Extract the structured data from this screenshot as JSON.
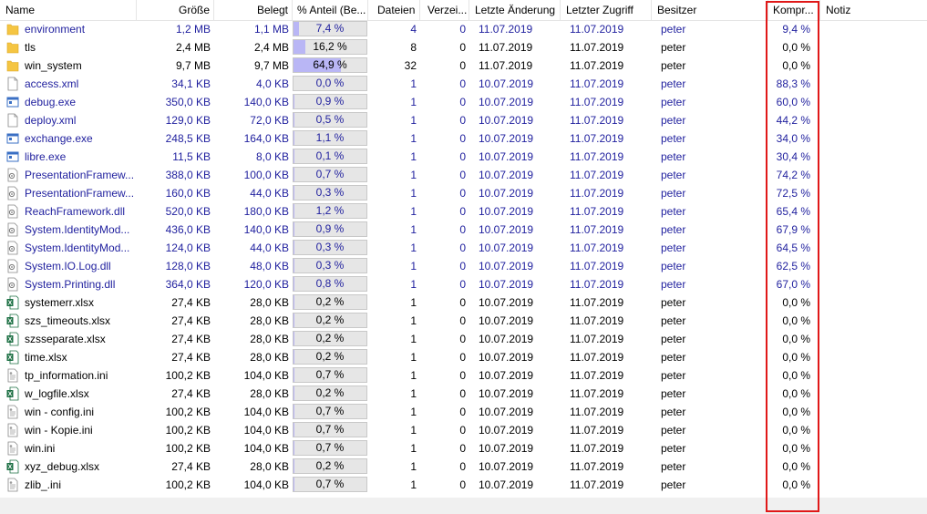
{
  "columns": {
    "name": "Name",
    "size": "Größe",
    "allocated": "Belegt",
    "percent": "% Anteil (Be...",
    "files": "Dateien",
    "folders": "Verzei...",
    "modified": "Letzte Änderung",
    "accessed": "Letzter Zugriff",
    "owner": "Besitzer",
    "compression": "Kompr...",
    "note": "Notiz"
  },
  "colors": {
    "blue_text": "#1f1f9e",
    "bar_fill": "#b9b6f5",
    "bar_bg": "#e6e6e6",
    "highlight_box": "#e01818"
  },
  "rows": [
    {
      "name": "environment",
      "icon": "folder-icon",
      "size": "1,2 MB",
      "alloc": "1,1 MB",
      "pct": "7,4 %",
      "pct_value": 7.4,
      "files": "4",
      "folders": "0",
      "mod": "11.07.2019",
      "acc": "11.07.2019",
      "owner": "peter",
      "comp": "9,4 %",
      "blue": true
    },
    {
      "name": "tls",
      "icon": "folder-icon",
      "size": "2,4 MB",
      "alloc": "2,4 MB",
      "pct": "16,2 %",
      "pct_value": 16.2,
      "files": "8",
      "folders": "0",
      "mod": "11.07.2019",
      "acc": "11.07.2019",
      "owner": "peter",
      "comp": "0,0 %",
      "blue": false
    },
    {
      "name": "win_system",
      "icon": "folder-icon",
      "size": "9,7 MB",
      "alloc": "9,7 MB",
      "pct": "64,9 %",
      "pct_value": 64.9,
      "files": "32",
      "folders": "0",
      "mod": "11.07.2019",
      "acc": "11.07.2019",
      "owner": "peter",
      "comp": "0,0 %",
      "blue": false
    },
    {
      "name": "access.xml",
      "icon": "xml-file-icon",
      "size": "34,1 KB",
      "alloc": "4,0 KB",
      "pct": "0,0 %",
      "pct_value": 0.0,
      "files": "1",
      "folders": "0",
      "mod": "10.07.2019",
      "acc": "11.07.2019",
      "owner": "peter",
      "comp": "88,3 %",
      "blue": true
    },
    {
      "name": "debug.exe",
      "icon": "exe-file-icon",
      "size": "350,0 KB",
      "alloc": "140,0 KB",
      "pct": "0,9 %",
      "pct_value": 0.9,
      "files": "1",
      "folders": "0",
      "mod": "10.07.2019",
      "acc": "11.07.2019",
      "owner": "peter",
      "comp": "60,0 %",
      "blue": true
    },
    {
      "name": "deploy.xml",
      "icon": "xml-file-icon",
      "size": "129,0 KB",
      "alloc": "72,0 KB",
      "pct": "0,5 %",
      "pct_value": 0.5,
      "files": "1",
      "folders": "0",
      "mod": "10.07.2019",
      "acc": "11.07.2019",
      "owner": "peter",
      "comp": "44,2 %",
      "blue": true
    },
    {
      "name": "exchange.exe",
      "icon": "exe-file-icon",
      "size": "248,5 KB",
      "alloc": "164,0 KB",
      "pct": "1,1 %",
      "pct_value": 1.1,
      "files": "1",
      "folders": "0",
      "mod": "10.07.2019",
      "acc": "11.07.2019",
      "owner": "peter",
      "comp": "34,0 %",
      "blue": true
    },
    {
      "name": "libre.exe",
      "icon": "exe-file-icon",
      "size": "11,5 KB",
      "alloc": "8,0 KB",
      "pct": "0,1 %",
      "pct_value": 0.1,
      "files": "1",
      "folders": "0",
      "mod": "10.07.2019",
      "acc": "11.07.2019",
      "owner": "peter",
      "comp": "30,4 %",
      "blue": true
    },
    {
      "name": "PresentationFramew...",
      "icon": "dll-file-icon",
      "size": "388,0 KB",
      "alloc": "100,0 KB",
      "pct": "0,7 %",
      "pct_value": 0.7,
      "files": "1",
      "folders": "0",
      "mod": "10.07.2019",
      "acc": "11.07.2019",
      "owner": "peter",
      "comp": "74,2 %",
      "blue": true
    },
    {
      "name": "PresentationFramew...",
      "icon": "dll-file-icon",
      "size": "160,0 KB",
      "alloc": "44,0 KB",
      "pct": "0,3 %",
      "pct_value": 0.3,
      "files": "1",
      "folders": "0",
      "mod": "10.07.2019",
      "acc": "11.07.2019",
      "owner": "peter",
      "comp": "72,5 %",
      "blue": true
    },
    {
      "name": "ReachFramework.dll",
      "icon": "dll-file-icon",
      "size": "520,0 KB",
      "alloc": "180,0 KB",
      "pct": "1,2 %",
      "pct_value": 1.2,
      "files": "1",
      "folders": "0",
      "mod": "10.07.2019",
      "acc": "11.07.2019",
      "owner": "peter",
      "comp": "65,4 %",
      "blue": true
    },
    {
      "name": "System.IdentityMod...",
      "icon": "dll-file-icon",
      "size": "436,0 KB",
      "alloc": "140,0 KB",
      "pct": "0,9 %",
      "pct_value": 0.9,
      "files": "1",
      "folders": "0",
      "mod": "10.07.2019",
      "acc": "11.07.2019",
      "owner": "peter",
      "comp": "67,9 %",
      "blue": true
    },
    {
      "name": "System.IdentityMod...",
      "icon": "dll-file-icon",
      "size": "124,0 KB",
      "alloc": "44,0 KB",
      "pct": "0,3 %",
      "pct_value": 0.3,
      "files": "1",
      "folders": "0",
      "mod": "10.07.2019",
      "acc": "11.07.2019",
      "owner": "peter",
      "comp": "64,5 %",
      "blue": true
    },
    {
      "name": "System.IO.Log.dll",
      "icon": "dll-file-icon",
      "size": "128,0 KB",
      "alloc": "48,0 KB",
      "pct": "0,3 %",
      "pct_value": 0.3,
      "files": "1",
      "folders": "0",
      "mod": "10.07.2019",
      "acc": "11.07.2019",
      "owner": "peter",
      "comp": "62,5 %",
      "blue": true
    },
    {
      "name": "System.Printing.dll",
      "icon": "dll-file-icon",
      "size": "364,0 KB",
      "alloc": "120,0 KB",
      "pct": "0,8 %",
      "pct_value": 0.8,
      "files": "1",
      "folders": "0",
      "mod": "10.07.2019",
      "acc": "11.07.2019",
      "owner": "peter",
      "comp": "67,0 %",
      "blue": true
    },
    {
      "name": "systemerr.xlsx",
      "icon": "excel-file-icon",
      "size": "27,4 KB",
      "alloc": "28,0 KB",
      "pct": "0,2 %",
      "pct_value": 0.2,
      "files": "1",
      "folders": "0",
      "mod": "10.07.2019",
      "acc": "11.07.2019",
      "owner": "peter",
      "comp": "0,0 %",
      "blue": false
    },
    {
      "name": "szs_timeouts.xlsx",
      "icon": "excel-file-icon",
      "size": "27,4 KB",
      "alloc": "28,0 KB",
      "pct": "0,2 %",
      "pct_value": 0.2,
      "files": "1",
      "folders": "0",
      "mod": "10.07.2019",
      "acc": "11.07.2019",
      "owner": "peter",
      "comp": "0,0 %",
      "blue": false
    },
    {
      "name": "szsseparate.xlsx",
      "icon": "excel-file-icon",
      "size": "27,4 KB",
      "alloc": "28,0 KB",
      "pct": "0,2 %",
      "pct_value": 0.2,
      "files": "1",
      "folders": "0",
      "mod": "10.07.2019",
      "acc": "11.07.2019",
      "owner": "peter",
      "comp": "0,0 %",
      "blue": false
    },
    {
      "name": "time.xlsx",
      "icon": "excel-file-icon",
      "size": "27,4 KB",
      "alloc": "28,0 KB",
      "pct": "0,2 %",
      "pct_value": 0.2,
      "files": "1",
      "folders": "0",
      "mod": "10.07.2019",
      "acc": "11.07.2019",
      "owner": "peter",
      "comp": "0,0 %",
      "blue": false
    },
    {
      "name": "tp_information.ini",
      "icon": "ini-file-icon",
      "size": "100,2 KB",
      "alloc": "104,0 KB",
      "pct": "0,7 %",
      "pct_value": 0.7,
      "files": "1",
      "folders": "0",
      "mod": "10.07.2019",
      "acc": "11.07.2019",
      "owner": "peter",
      "comp": "0,0 %",
      "blue": false
    },
    {
      "name": "w_logfile.xlsx",
      "icon": "excel-file-icon",
      "size": "27,4 KB",
      "alloc": "28,0 KB",
      "pct": "0,2 %",
      "pct_value": 0.2,
      "files": "1",
      "folders": "0",
      "mod": "10.07.2019",
      "acc": "11.07.2019",
      "owner": "peter",
      "comp": "0,0 %",
      "blue": false
    },
    {
      "name": "win - config.ini",
      "icon": "ini-file-icon",
      "size": "100,2 KB",
      "alloc": "104,0 KB",
      "pct": "0,7 %",
      "pct_value": 0.7,
      "files": "1",
      "folders": "0",
      "mod": "10.07.2019",
      "acc": "11.07.2019",
      "owner": "peter",
      "comp": "0,0 %",
      "blue": false
    },
    {
      "name": "win - Kopie.ini",
      "icon": "ini-file-icon",
      "size": "100,2 KB",
      "alloc": "104,0 KB",
      "pct": "0,7 %",
      "pct_value": 0.7,
      "files": "1",
      "folders": "0",
      "mod": "10.07.2019",
      "acc": "11.07.2019",
      "owner": "peter",
      "comp": "0,0 %",
      "blue": false
    },
    {
      "name": "win.ini",
      "icon": "ini-file-icon",
      "size": "100,2 KB",
      "alloc": "104,0 KB",
      "pct": "0,7 %",
      "pct_value": 0.7,
      "files": "1",
      "folders": "0",
      "mod": "10.07.2019",
      "acc": "11.07.2019",
      "owner": "peter",
      "comp": "0,0 %",
      "blue": false
    },
    {
      "name": "xyz_debug.xlsx",
      "icon": "excel-file-icon",
      "size": "27,4 KB",
      "alloc": "28,0 KB",
      "pct": "0,2 %",
      "pct_value": 0.2,
      "files": "1",
      "folders": "0",
      "mod": "10.07.2019",
      "acc": "11.07.2019",
      "owner": "peter",
      "comp": "0,0 %",
      "blue": false
    },
    {
      "name": "zlib_.ini",
      "icon": "ini-file-icon",
      "size": "100,2 KB",
      "alloc": "104,0 KB",
      "pct": "0,7 %",
      "pct_value": 0.7,
      "files": "1",
      "folders": "0",
      "mod": "10.07.2019",
      "acc": "11.07.2019",
      "owner": "peter",
      "comp": "0,0 %",
      "blue": false
    }
  ]
}
